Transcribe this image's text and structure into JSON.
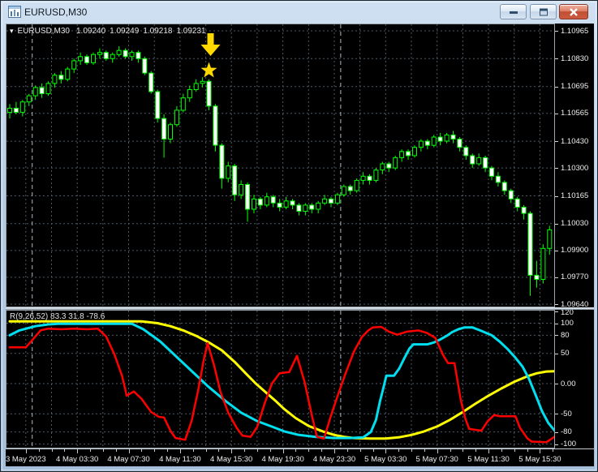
{
  "window": {
    "title": "EURUSD,M30"
  },
  "icons": {
    "dropdown": "▾"
  },
  "main_chart": {
    "header": {
      "symbol": "EURUSD,M30",
      "open": "1.09240",
      "high": "1.09249",
      "low": "1.09218",
      "close": "1.09231"
    }
  },
  "indicator_panel": {
    "header": "R(9,26,52) 83.3 31.8 -78.6"
  },
  "colors": {
    "background": "#000000",
    "grid": "#4d5a66",
    "day_separator": "#aeb9c4",
    "candle": "#00ff00",
    "bull_fill": "#000000",
    "bear_fill": "#ffffff",
    "arrow": "#ffd800",
    "star": "#ffd800",
    "red_line": "#ff0000",
    "cyan_line": "#00dff0",
    "yellow_line": "#ffff00",
    "axis_text": "#efefef"
  },
  "chart_data": {
    "type": "candlestick",
    "symbol": "EURUSD",
    "timeframe": "M30",
    "price_scale": {
      "max": 1.10965,
      "min": 1.0964
    },
    "pip_base": 1.09,
    "price_axis_labels": [
      "1.10965",
      "1.10830",
      "1.10695",
      "1.10565",
      "1.10430",
      "1.10300",
      "1.10165",
      "1.10030",
      "1.09900",
      "1.09770",
      "1.09640"
    ],
    "indicator_axis_labels": [
      "120",
      "100",
      "80",
      "50",
      "0.00",
      "-50",
      "-80",
      "-100"
    ],
    "time_labels": [
      "3 May 2023",
      "4 May 03:30",
      "4 May 07:30",
      "4 May 11:30",
      "4 May 15:30",
      "4 May 19:30",
      "4 May 23:30",
      "5 May 03:30",
      "5 May 07:30",
      "5 May 11:30",
      "5 May 15:30"
    ],
    "day_separator_bars": [
      3.5,
      51.5
    ],
    "candles": [
      [
        157,
        161,
        154,
        159
      ],
      [
        159,
        162,
        156,
        157
      ],
      [
        157,
        163,
        155,
        162
      ],
      [
        162,
        166,
        160,
        165
      ],
      [
        165,
        170,
        163,
        169
      ],
      [
        169,
        171,
        164,
        166
      ],
      [
        166,
        172,
        165,
        171
      ],
      [
        171,
        176,
        169,
        175
      ],
      [
        175,
        177,
        171,
        173
      ],
      [
        173,
        179,
        172,
        178
      ],
      [
        178,
        183,
        176,
        182
      ],
      [
        182,
        186,
        180,
        184
      ],
      [
        184,
        185,
        180,
        181
      ],
      [
        181,
        186,
        180,
        185
      ],
      [
        185,
        188,
        183,
        186
      ],
      [
        186,
        187,
        182,
        183
      ],
      [
        183,
        186,
        181,
        185
      ],
      [
        185,
        189,
        184,
        187
      ],
      [
        187,
        188,
        183,
        184
      ],
      [
        184,
        187,
        182,
        186
      ],
      [
        186,
        187,
        181,
        183
      ],
      [
        183,
        184,
        175,
        176
      ],
      [
        176,
        177,
        166,
        167
      ],
      [
        167,
        168,
        152,
        154
      ],
      [
        154,
        156,
        135,
        144
      ],
      [
        144,
        152,
        142,
        151
      ],
      [
        151,
        160,
        150,
        158
      ],
      [
        158,
        166,
        157,
        164
      ],
      [
        164,
        170,
        162,
        168
      ],
      [
        168,
        173,
        167,
        171
      ],
      [
        171,
        174,
        169,
        172
      ],
      [
        172,
        173,
        158,
        160
      ],
      [
        160,
        161,
        138,
        141
      ],
      [
        141,
        142,
        120,
        125
      ],
      [
        125,
        133,
        123,
        131
      ],
      [
        131,
        132,
        114,
        117
      ],
      [
        117,
        124,
        115,
        122
      ],
      [
        122,
        123,
        104,
        110
      ],
      [
        110,
        117,
        108,
        115
      ],
      [
        115,
        116,
        110,
        112
      ],
      [
        112,
        118,
        111,
        116
      ],
      [
        116,
        117,
        111,
        113
      ],
      [
        113,
        115,
        109,
        111
      ],
      [
        111,
        116,
        110,
        114
      ],
      [
        114,
        115,
        110,
        112
      ],
      [
        112,
        113,
        107,
        109
      ],
      [
        109,
        113,
        107,
        112
      ],
      [
        112,
        113,
        108,
        110
      ],
      [
        110,
        114,
        108,
        113
      ],
      [
        113,
        117,
        112,
        115
      ],
      [
        115,
        116,
        111,
        113
      ],
      [
        113,
        118,
        112,
        117
      ],
      [
        117,
        122,
        116,
        121
      ],
      [
        121,
        122,
        117,
        119
      ],
      [
        119,
        125,
        118,
        124
      ],
      [
        124,
        128,
        122,
        126
      ],
      [
        126,
        127,
        122,
        124
      ],
      [
        124,
        130,
        123,
        129
      ],
      [
        129,
        133,
        127,
        132
      ],
      [
        132,
        133,
        128,
        130
      ],
      [
        130,
        136,
        129,
        135
      ],
      [
        135,
        139,
        133,
        138
      ],
      [
        138,
        139,
        134,
        136
      ],
      [
        136,
        141,
        135,
        140
      ],
      [
        140,
        144,
        138,
        143
      ],
      [
        143,
        144,
        139,
        141
      ],
      [
        141,
        146,
        140,
        145
      ],
      [
        145,
        147,
        141,
        143
      ],
      [
        143,
        147,
        142,
        146
      ],
      [
        146,
        148,
        142,
        144
      ],
      [
        144,
        145,
        138,
        140
      ],
      [
        140,
        141,
        134,
        136
      ],
      [
        136,
        137,
        130,
        132
      ],
      [
        132,
        137,
        131,
        135
      ],
      [
        135,
        136,
        128,
        130
      ],
      [
        130,
        131,
        124,
        126
      ],
      [
        126,
        128,
        121,
        123
      ],
      [
        123,
        124,
        117,
        119
      ],
      [
        119,
        120,
        113,
        115
      ],
      [
        115,
        116,
        109,
        111
      ],
      [
        111,
        112,
        105,
        108
      ],
      [
        108,
        109,
        68,
        78
      ],
      [
        78,
        85,
        72,
        76
      ],
      [
        76,
        93,
        74,
        91
      ],
      [
        91,
        102,
        88,
        100
      ]
    ],
    "annotations": [
      {
        "type": "arrow-down",
        "bar": 31,
        "color": "#ffd800"
      },
      {
        "type": "star",
        "bar": 31,
        "color": "#ffd800"
      }
    ],
    "indicator": {
      "name": "R(9,26,52)",
      "current_values": [
        83.3,
        31.8,
        -78.6
      ],
      "levels": [
        120,
        100,
        80,
        50,
        0,
        -50,
        -80,
        -100
      ],
      "series": [
        {
          "name": "slow-yellow",
          "color": "#ffff00",
          "width": 3,
          "points": [
            [
              0,
              103
            ],
            [
              20.5,
              103
            ],
            [
              23,
              100
            ],
            [
              25,
              95
            ],
            [
              27,
              88
            ],
            [
              29,
              79
            ],
            [
              31,
              68
            ],
            [
              33,
              55
            ],
            [
              35,
              36
            ],
            [
              36.8,
              16
            ],
            [
              38.3,
              0
            ],
            [
              40,
              -16
            ],
            [
              41.5,
              -30
            ],
            [
              42.7,
              -42
            ],
            [
              44.5,
              -57
            ],
            [
              46.5,
              -70
            ],
            [
              48.7,
              -79
            ],
            [
              50.5,
              -85
            ],
            [
              52,
              -88
            ],
            [
              53.5,
              -90
            ],
            [
              56,
              -91
            ],
            [
              58.5,
              -91
            ],
            [
              60.5,
              -89
            ],
            [
              62.5,
              -85
            ],
            [
              64.5,
              -79
            ],
            [
              66.5,
              -71
            ],
            [
              68.5,
              -60
            ],
            [
              70.5,
              -47
            ],
            [
              72.5,
              -33
            ],
            [
              74.5,
              -20
            ],
            [
              76.5,
              -8
            ],
            [
              78.5,
              3
            ],
            [
              80.5,
              12
            ],
            [
              82,
              17
            ],
            [
              83.5,
              20
            ],
            [
              85.6,
              21
            ]
          ]
        },
        {
          "name": "medium-cyan",
          "color": "#00dff0",
          "width": 3,
          "points": [
            [
              0,
              80
            ],
            [
              1.5,
              88
            ],
            [
              4,
              95
            ],
            [
              6,
              98
            ],
            [
              7.5,
              99
            ],
            [
              19,
              99
            ],
            [
              20.8,
              90
            ],
            [
              23.4,
              70
            ],
            [
              25.9,
              45
            ],
            [
              28.4,
              20
            ],
            [
              30.9,
              -5
            ],
            [
              33.5,
              -28
            ],
            [
              36,
              -48
            ],
            [
              38.5,
              -62
            ],
            [
              41,
              -72
            ],
            [
              42.7,
              -79
            ],
            [
              45,
              -85
            ],
            [
              47.5,
              -88
            ],
            [
              50.5,
              -90
            ],
            [
              53,
              -90
            ],
            [
              55,
              -89
            ],
            [
              56.2,
              -80
            ],
            [
              57,
              -60
            ],
            [
              57.6,
              -30
            ],
            [
              58.2,
              -5
            ],
            [
              58.6,
              13
            ],
            [
              59.8,
              13
            ],
            [
              60.6,
              25
            ],
            [
              61.4,
              42
            ],
            [
              62.2,
              58
            ],
            [
              62.8,
              65
            ],
            [
              65,
              65
            ],
            [
              66,
              68
            ],
            [
              67,
              73
            ],
            [
              68,
              79
            ],
            [
              68.8,
              85
            ],
            [
              69.8,
              90
            ],
            [
              70.8,
              93
            ],
            [
              72,
              93
            ],
            [
              73.2,
              88
            ],
            [
              75,
              80
            ],
            [
              76.2,
              70
            ],
            [
              77.4,
              58
            ],
            [
              78.6,
              44
            ],
            [
              79.8,
              28
            ],
            [
              80.8,
              8
            ],
            [
              81.8,
              -18
            ],
            [
              82.8,
              -45
            ],
            [
              83.8,
              -65
            ],
            [
              84.8,
              -78
            ],
            [
              85.6,
              -83
            ]
          ]
        },
        {
          "name": "fast-red",
          "color": "#ff0000",
          "width": 2.5,
          "points": [
            [
              0,
              60
            ],
            [
              2.5,
              60
            ],
            [
              3.5,
              72
            ],
            [
              4.8,
              88
            ],
            [
              6,
              91
            ],
            [
              8,
              90
            ],
            [
              10,
              91
            ],
            [
              12,
              90
            ],
            [
              13.7,
              91
            ],
            [
              15,
              78
            ],
            [
              16.3,
              48
            ],
            [
              17.5,
              12
            ],
            [
              18.2,
              -20
            ],
            [
              19.3,
              -13
            ],
            [
              20.5,
              -25
            ],
            [
              22,
              -47
            ],
            [
              23.2,
              -55
            ],
            [
              24,
              -56
            ],
            [
              25,
              -78
            ],
            [
              25.8,
              -90
            ],
            [
              27.3,
              -93
            ],
            [
              28.3,
              -62
            ],
            [
              29.3,
              -12
            ],
            [
              30.2,
              40
            ],
            [
              30.8,
              67
            ],
            [
              31.8,
              30
            ],
            [
              32.8,
              -14
            ],
            [
              34,
              -48
            ],
            [
              35.3,
              -73
            ],
            [
              36.2,
              -86
            ],
            [
              37.5,
              -88
            ],
            [
              38.5,
              -72
            ],
            [
              39.7,
              -32
            ],
            [
              40.8,
              0
            ],
            [
              42,
              17
            ],
            [
              43.5,
              19
            ],
            [
              44.7,
              46
            ],
            [
              45.9,
              2
            ],
            [
              47,
              -52
            ],
            [
              47.8,
              -88
            ],
            [
              48.9,
              -91
            ],
            [
              49.9,
              -56
            ],
            [
              51,
              -21
            ],
            [
              52.3,
              18
            ],
            [
              53.6,
              54
            ],
            [
              54.8,
              77
            ],
            [
              55.8,
              88
            ],
            [
              56.5,
              93
            ],
            [
              57.8,
              94
            ],
            [
              59,
              86
            ],
            [
              60.3,
              81
            ],
            [
              61.8,
              86
            ],
            [
              63.6,
              88
            ],
            [
              64.9,
              84
            ],
            [
              66.2,
              76
            ],
            [
              67.5,
              46
            ],
            [
              68.2,
              34
            ],
            [
              69.2,
              34
            ],
            [
              70.2,
              -28
            ],
            [
              70.9,
              -58
            ],
            [
              71.5,
              -75
            ],
            [
              73.4,
              -78
            ],
            [
              74.4,
              -62
            ],
            [
              75.4,
              -52
            ],
            [
              76.2,
              -54
            ],
            [
              78.7,
              -54
            ],
            [
              79.4,
              -73
            ],
            [
              80.5,
              -90
            ],
            [
              81.2,
              -96
            ],
            [
              83.5,
              -97
            ],
            [
              84.5,
              -90
            ],
            [
              85.4,
              -82
            ]
          ]
        }
      ]
    }
  }
}
